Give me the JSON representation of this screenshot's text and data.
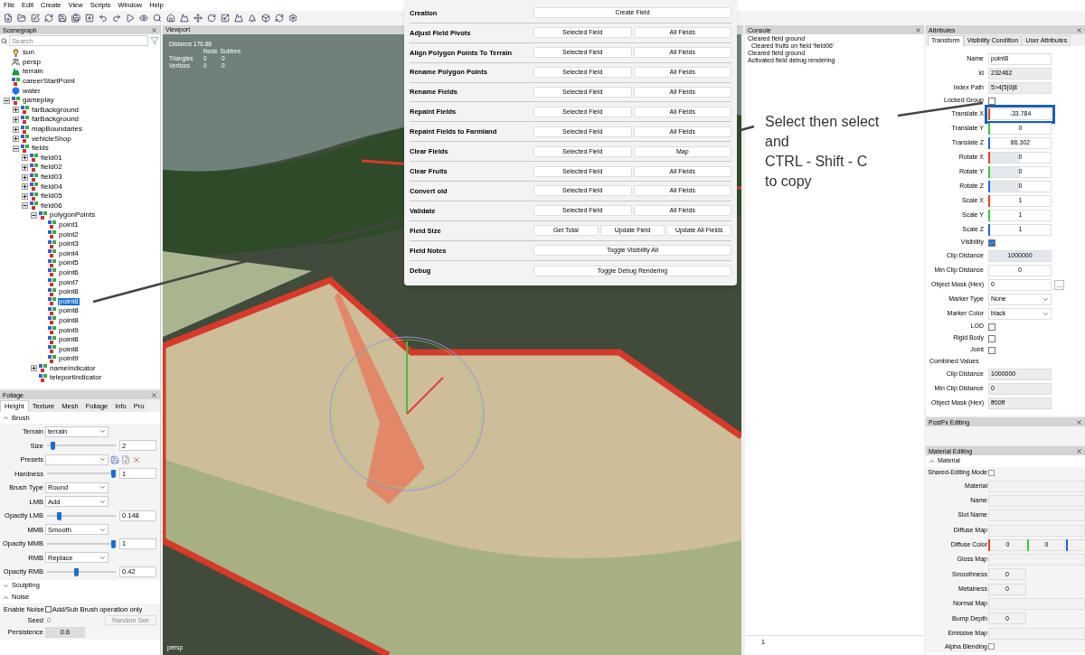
{
  "menu": [
    "File",
    "Edit",
    "Create",
    "View",
    "Scripts",
    "Window",
    "Help"
  ],
  "scenegraph": {
    "title": "Scenegraph",
    "search": {
      "placeholder": "Search"
    },
    "items": [
      {
        "label": "sun",
        "kind": "light",
        "selected": false
      },
      {
        "label": "persp",
        "kind": "camera",
        "selected": false
      },
      {
        "label": "terrain",
        "kind": "terrain",
        "selected": false
      },
      {
        "label": "careerStartPoint",
        "kind": "transform",
        "selected": false
      },
      {
        "label": "water",
        "kind": "water",
        "selected": false
      },
      {
        "label": "gameplay",
        "kind": "transform",
        "selected": false,
        "expanded": true,
        "children": [
          {
            "label": "farBackground",
            "kind": "transform",
            "selected": false,
            "expanded": false
          },
          {
            "label": "farBackground",
            "kind": "transform",
            "selected": false,
            "expanded": false
          },
          {
            "label": "mapBoundaries",
            "kind": "transform",
            "selected": false,
            "expanded": false
          },
          {
            "label": "vehicleShop",
            "kind": "transform",
            "selected": false,
            "expanded": false
          },
          {
            "label": "fields",
            "kind": "transform",
            "selected": false,
            "expanded": true,
            "children": [
              {
                "label": "field01",
                "kind": "transform",
                "selected": false,
                "expanded": false
              },
              {
                "label": "field02",
                "kind": "transform",
                "selected": false,
                "expanded": false
              },
              {
                "label": "field03",
                "kind": "transform",
                "selected": false,
                "expanded": false
              },
              {
                "label": "field04",
                "kind": "transform",
                "selected": false,
                "expanded": false
              },
              {
                "label": "field05",
                "kind": "transform",
                "selected": false,
                "expanded": false
              },
              {
                "label": "field06",
                "kind": "transform",
                "selected": false,
                "expanded": true,
                "children": [
                  {
                    "label": "polygonPoints",
                    "kind": "transform",
                    "selected": false,
                    "expanded": true,
                    "children": [
                      {
                        "label": "point1",
                        "kind": "transform",
                        "selected": false
                      },
                      {
                        "label": "point2",
                        "kind": "transform",
                        "selected": false
                      },
                      {
                        "label": "point3",
                        "kind": "transform",
                        "selected": false
                      },
                      {
                        "label": "point4",
                        "kind": "transform",
                        "selected": false
                      },
                      {
                        "label": "point5",
                        "kind": "transform",
                        "selected": false
                      },
                      {
                        "label": "point6",
                        "kind": "transform",
                        "selected": false
                      },
                      {
                        "label": "point7",
                        "kind": "transform",
                        "selected": false
                      },
                      {
                        "label": "point8",
                        "kind": "transform",
                        "selected": false
                      },
                      {
                        "label": "point8",
                        "kind": "transform",
                        "selected": true
                      },
                      {
                        "label": "point8",
                        "kind": "transform",
                        "selected": false
                      },
                      {
                        "label": "point8",
                        "kind": "transform",
                        "selected": false
                      },
                      {
                        "label": "point9",
                        "kind": "transform",
                        "selected": false
                      },
                      {
                        "label": "point8",
                        "kind": "transform",
                        "selected": false
                      },
                      {
                        "label": "point8",
                        "kind": "transform",
                        "selected": false
                      },
                      {
                        "label": "point9",
                        "kind": "transform",
                        "selected": false
                      }
                    ]
                  },
                  {
                    "label": "nameIndicator",
                    "kind": "transform",
                    "selected": false,
                    "expanded": false
                  },
                  {
                    "label": "teleportIndicator",
                    "kind": "transform",
                    "selected": false
                  }
                ]
              }
            ]
          }
        ]
      }
    ]
  },
  "foliage": {
    "title": "Foliage",
    "tabs": [
      {
        "label": "Height",
        "selected": true
      },
      {
        "label": "Texture",
        "selected": false
      },
      {
        "label": "Mesh",
        "selected": false
      },
      {
        "label": "Foliage",
        "selected": false
      },
      {
        "label": "Info",
        "selected": false
      },
      {
        "label": "Pro",
        "selected": false
      }
    ],
    "sections": [
      {
        "title": "Brush",
        "expanded": true,
        "rows": [
          {
            "kind": "dropdown",
            "label": "Terrain",
            "value": "terrain"
          },
          {
            "kind": "slider",
            "label": "Size",
            "level": 0.05,
            "value": "2"
          },
          {
            "kind": "presets",
            "label": "Presets"
          },
          {
            "kind": "slider",
            "label": "Hardness",
            "level": 1,
            "value": "1"
          },
          {
            "kind": "dropdown",
            "label": "Brush Type",
            "value": "Round"
          },
          {
            "kind": "dropdown",
            "label": "LMB",
            "value": "Add"
          },
          {
            "kind": "slider",
            "label": "Opacity LMB",
            "level": 0.15,
            "value": "0.148"
          },
          {
            "kind": "dropdown",
            "label": "MMB",
            "value": "Smooth"
          },
          {
            "kind": "slider",
            "label": "Opacity MMB",
            "level": 1,
            "value": "1"
          },
          {
            "kind": "dropdown",
            "label": "RMB",
            "value": "Replace"
          },
          {
            "kind": "slider",
            "label": "Opacity RMB",
            "level": 0.42,
            "value": "0.42"
          }
        ]
      },
      {
        "title": "Sculpting",
        "expanded": false
      },
      {
        "title": "Noise",
        "expanded": true,
        "rows": [
          {
            "kind": "checkbox",
            "label": "Enable Noise",
            "checked": false,
            "text": "Add/Sub Brush operation only"
          },
          {
            "kind": "seed",
            "label": "Seed",
            "value": "0",
            "button": "Random See"
          },
          {
            "kind": "number",
            "label": "Persistence",
            "value": "0.6"
          }
        ]
      }
    ]
  },
  "viewport": {
    "title": "Viewport",
    "distance": "Distance 176.88",
    "columns": [
      "Node",
      "Subtree"
    ],
    "stats": [
      {
        "label": "Triangles",
        "node": "0",
        "subtree": "0"
      },
      {
        "label": "Vertices",
        "node": "0",
        "subtree": "0"
      }
    ],
    "camera": "persp"
  },
  "field_tools": {
    "rows": [
      {
        "label": "Creation",
        "buttons": [
          "Create Field"
        ]
      },
      {
        "label": "Adjust Field Pivots",
        "buttons": [
          "Selected Field",
          "All Fields"
        ]
      },
      {
        "label": "Align Polygon Points To Terrain",
        "buttons": [
          "Selected Field",
          "All Fields"
        ]
      },
      {
        "label": "Rename Polygon Points",
        "buttons": [
          "Selected Field",
          "All Fields"
        ]
      },
      {
        "label": "Rename Fields",
        "buttons": [
          "Selected Field",
          "All Fields"
        ]
      },
      {
        "label": "Repaint Fields",
        "buttons": [
          "Selected Field",
          "All Fields"
        ]
      },
      {
        "label": "Repaint Fields to Farmland",
        "buttons": [
          "Selected Field",
          "All Fields"
        ]
      },
      {
        "label": "Clear Fields",
        "buttons": [
          "Selected Field",
          "Map"
        ]
      },
      {
        "label": "Clear Fruits",
        "buttons": [
          "Selected Field",
          "All Fields"
        ]
      },
      {
        "label": "Convert old",
        "buttons": [
          "Selected Field",
          "All Fields"
        ]
      },
      {
        "label": "Validate",
        "buttons": [
          "Selected Field",
          "All Fields"
        ]
      },
      {
        "label": "Field Size",
        "buttons": [
          "Get Total",
          "Update Field",
          "Update All Fields"
        ]
      },
      {
        "label": "Field Notes",
        "buttons": [
          "Toggle Visibility All"
        ]
      },
      {
        "label": "Debug",
        "buttons": [
          "Toggle Debug Rendering"
        ]
      }
    ]
  },
  "console": {
    "title": "Console",
    "lines": [
      "Cleared field ground",
      "  Cleared fruits on field 'field06'",
      "Cleared field ground",
      "Activated field debug rendering"
    ],
    "line_number": "1"
  },
  "attributes": {
    "title": "Attributes",
    "tabs": [
      {
        "label": "Transform",
        "selected": true
      },
      {
        "label": "Visibility Condition",
        "selected": false
      },
      {
        "label": "User Attributes",
        "selected": false
      }
    ],
    "rows": [
      {
        "kind": "text",
        "label": "Name",
        "value": "point8"
      },
      {
        "kind": "readonly",
        "label": "Id",
        "value": "232462"
      },
      {
        "kind": "readonly",
        "label": "Index Path",
        "value": "5>4|5|0|8"
      },
      {
        "kind": "checkbox",
        "label": "Locked Group",
        "checked": false
      },
      {
        "kind": "axis",
        "label": "Translate X",
        "value": "-33.784",
        "color": "#e8401c",
        "highlighted": true
      },
      {
        "kind": "axis",
        "label": "Translate Y",
        "value": "0",
        "color": "#3cc83c",
        "highlighted": false
      },
      {
        "kind": "axis",
        "label": "Translate Z",
        "value": "86.302",
        "color": "#1c64e8",
        "highlighted": false
      },
      {
        "kind": "rotate",
        "label": "Rotate X",
        "value": "0",
        "color": "#e8401c",
        "highlighted": false
      },
      {
        "kind": "rotate",
        "label": "Rotate Y",
        "value": "0",
        "color": "#3cc83c",
        "highlighted": false
      },
      {
        "kind": "rotate",
        "label": "Rotate Z",
        "value": "0",
        "color": "#1c64e8",
        "highlighted": false
      },
      {
        "kind": "axis",
        "label": "Scale X",
        "value": "1",
        "color": "#e8401c",
        "highlighted": false
      },
      {
        "kind": "axis",
        "label": "Scale Y",
        "value": "1",
        "color": "#3cc83c",
        "highlighted": false
      },
      {
        "kind": "axis",
        "label": "Scale Z",
        "value": "1",
        "color": "#1c64e8",
        "highlighted": false
      },
      {
        "kind": "checkbox",
        "label": "Visibility",
        "checked": true
      },
      {
        "kind": "gray",
        "label": "Clip Distance",
        "value": "1000000"
      },
      {
        "kind": "number",
        "label": "Min Clip Distance",
        "value": "0"
      },
      {
        "kind": "mask",
        "label": "Object Mask (Hex)",
        "value": "0",
        "button": "..."
      },
      {
        "kind": "dropdown",
        "label": "Marker Type",
        "value": "None"
      },
      {
        "kind": "dropdown",
        "label": "Marker Color",
        "value": "black"
      },
      {
        "kind": "checkbox",
        "label": "LOD",
        "checked": false
      },
      {
        "kind": "checkbox",
        "label": "Rigid Body",
        "checked": false
      },
      {
        "kind": "checkbox",
        "label": "Joint",
        "checked": false
      },
      {
        "kind": "heading",
        "label": "Combined Values"
      },
      {
        "kind": "readonly",
        "label": "Clip Distance",
        "value": "1000000"
      },
      {
        "kind": "readonly",
        "label": "Min Clip Distance",
        "value": "0"
      },
      {
        "kind": "readonly",
        "label": "Object Mask (Hex)",
        "value": "ff00ff"
      }
    ]
  },
  "postfx": {
    "title": "PostFx Editing"
  },
  "material": {
    "title": "Material Editing",
    "section": {
      "title": "Material",
      "expanded": true
    },
    "rows": [
      {
        "kind": "checkbox",
        "label": "Shared-Editing Mode",
        "checked": false
      },
      {
        "kind": "field",
        "label": "Material"
      },
      {
        "kind": "field",
        "label": "Name"
      },
      {
        "kind": "field",
        "label": "Slot Name"
      },
      {
        "kind": "field",
        "label": "Diffuse Map"
      },
      {
        "kind": "color",
        "label": "Diffuse Color",
        "channels": [
          {
            "value": "0",
            "color": "#e8401c"
          },
          {
            "value": "0",
            "color": "#3cc83c"
          },
          {
            "color": "#1c64e8"
          }
        ]
      },
      {
        "kind": "field",
        "label": "Gloss Map"
      },
      {
        "kind": "small",
        "label": "Smoothness",
        "value": "0"
      },
      {
        "kind": "small",
        "label": "Metalness",
        "value": "0"
      },
      {
        "kind": "field",
        "label": "Normal Map"
      },
      {
        "kind": "small",
        "label": "Bump Depth",
        "value": "0"
      },
      {
        "kind": "field",
        "label": "Emissive Map"
      },
      {
        "kind": "checkbox",
        "label": "Alpha Blending",
        "checked": false
      }
    ]
  },
  "annotation": {
    "text": "Select then select\nand\nCTRL - Shift - C\nto copy"
  }
}
